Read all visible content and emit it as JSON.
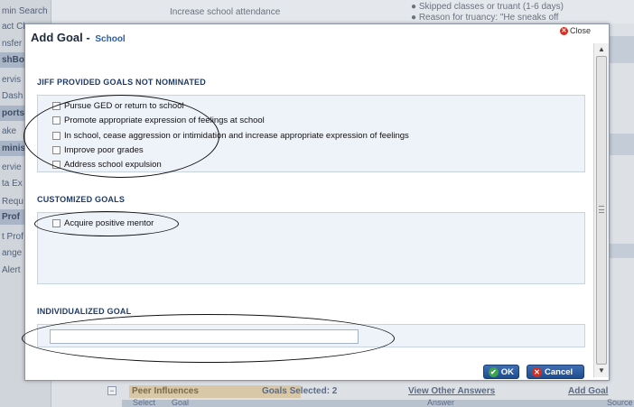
{
  "background": {
    "sidebar": [
      {
        "label": "min Search",
        "header": false
      },
      {
        "label": "act Cl",
        "header": false
      },
      {
        "label": "nsfer",
        "header": false
      },
      {
        "label": "shBoa",
        "header": true
      },
      {
        "label": "ervis",
        "header": false
      },
      {
        "label": "Dash",
        "header": false
      },
      {
        "label": "ports",
        "header": true
      },
      {
        "label": "ake",
        "header": false
      },
      {
        "label": "minis",
        "header": true
      },
      {
        "label": "ervie",
        "header": false
      },
      {
        "label": "ta Ex",
        "header": false
      },
      {
        "label": "Requ",
        "header": false
      },
      {
        "label": "Prof",
        "header": true
      },
      {
        "label": "t Prof",
        "header": false
      },
      {
        "label": "ange",
        "header": false
      },
      {
        "label": "Alert",
        "header": false
      }
    ],
    "top_row_goal": "Increase school attendance",
    "top_row_answers": [
      "Skipped classes or truant (1-6 days)",
      "Reason for truancy: \"He sneaks off"
    ],
    "bottom_row": {
      "category": "Peer Influences",
      "goals_selected": "Goals Selected: 2",
      "view_other": "View Other Answers",
      "add_goal": "Add Goal",
      "col_select": "Select",
      "col_goal": "Goal",
      "col_answer": "Answer",
      "col_source": "Source"
    }
  },
  "modal": {
    "title": "Add Goal",
    "dash": "-",
    "subtitle": "School",
    "close_label": "Close",
    "sections": {
      "jiff": {
        "title": "JIFF PROVIDED GOALS NOT NOMINATED",
        "options": [
          "Pursue GED or return to school",
          "Promote appropriate expression of feelings at school",
          "In school, cease aggression or intimidation and increase appropriate expression of feelings",
          "Improve poor grades",
          "Address school expulsion"
        ]
      },
      "customized": {
        "title": "CUSTOMIZED GOALS",
        "options": [
          "Acquire positive mentor"
        ]
      },
      "individualized": {
        "title": "INDIVIDUALIZED GOAL",
        "value": ""
      }
    },
    "ok_label": "OK",
    "cancel_label": "Cancel"
  },
  "colors": {
    "section_title": "#203a66",
    "section_bg": "#eef3fa",
    "button": "#2a5ea3",
    "ok_icon": "#3aa548",
    "cancel_icon": "#d62d20"
  },
  "icons": [
    "close-icon",
    "check-icon",
    "cancel-icon",
    "checkbox-icon"
  ]
}
